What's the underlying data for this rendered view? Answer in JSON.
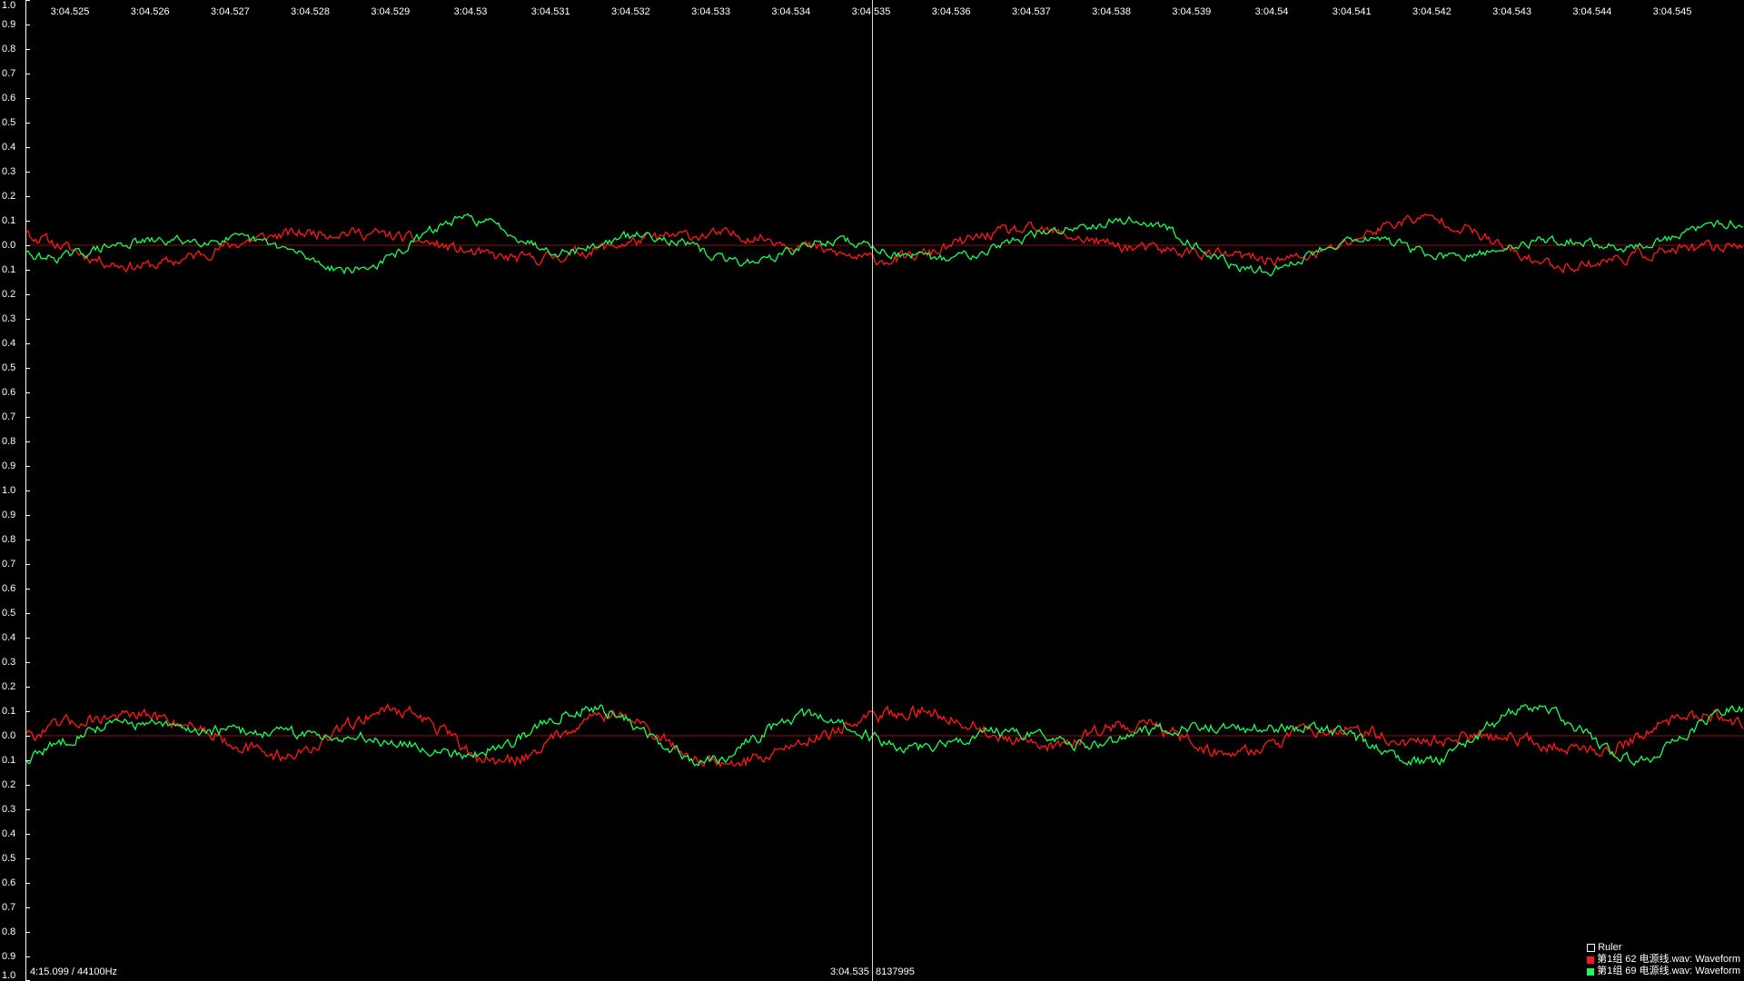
{
  "amplitude_labels": [
    "1.0",
    "0.9",
    "0.8",
    "0.7",
    "0.6",
    "0.5",
    "0.4",
    "0.3",
    "0.2",
    "0.1",
    "0.0",
    "0.1",
    "0.2",
    "0.3",
    "0.4",
    "0.5",
    "0.6",
    "0.7",
    "0.8",
    "0.9",
    "1.0",
    "0.9",
    "0.8",
    "0.7",
    "0.6",
    "0.5",
    "0.4",
    "0.3",
    "0.2",
    "0.1",
    "0.0",
    "0.1",
    "0.2",
    "0.3",
    "0.4",
    "0.5",
    "0.6",
    "0.7",
    "0.8",
    "0.9",
    "1.0"
  ],
  "time_labels": [
    "3:04.525",
    "3:04.526",
    "3:04.527",
    "3:04.528",
    "3:04.529",
    "3:04.53",
    "3:04.531",
    "3:04.532",
    "3:04.533",
    "3:04.534",
    "3:04.535",
    "3:04.536",
    "3:04.537",
    "3:04.538",
    "3:04.539",
    "3:04.54",
    "3:04.541",
    "3:04.542",
    "3:04.543",
    "3:04.544",
    "3:04.545"
  ],
  "status": {
    "total": "4:15.099 / 44100Hz",
    "cursor_time": "3:04.535",
    "cursor_sample": "8137995"
  },
  "legend": [
    {
      "label": "Ruler",
      "color": "#ffffff",
      "kind": "outline"
    },
    {
      "label": "第1组 62 电源线.wav: Waveform",
      "color": "#ff1a1a",
      "kind": "fill"
    },
    {
      "label": "第1组 69 电源线.wav: Waveform",
      "color": "#1aff5a",
      "kind": "fill"
    }
  ],
  "colors": {
    "background": "#000000",
    "series_red": "#ff1a1a",
    "series_green": "#1aff5a",
    "axis": "#ffffff",
    "cursor": "#d8d8d8",
    "zero_line": "#8a1010"
  },
  "channels": [
    "top",
    "bottom"
  ],
  "waveform_amplitude_max": 0.15
}
